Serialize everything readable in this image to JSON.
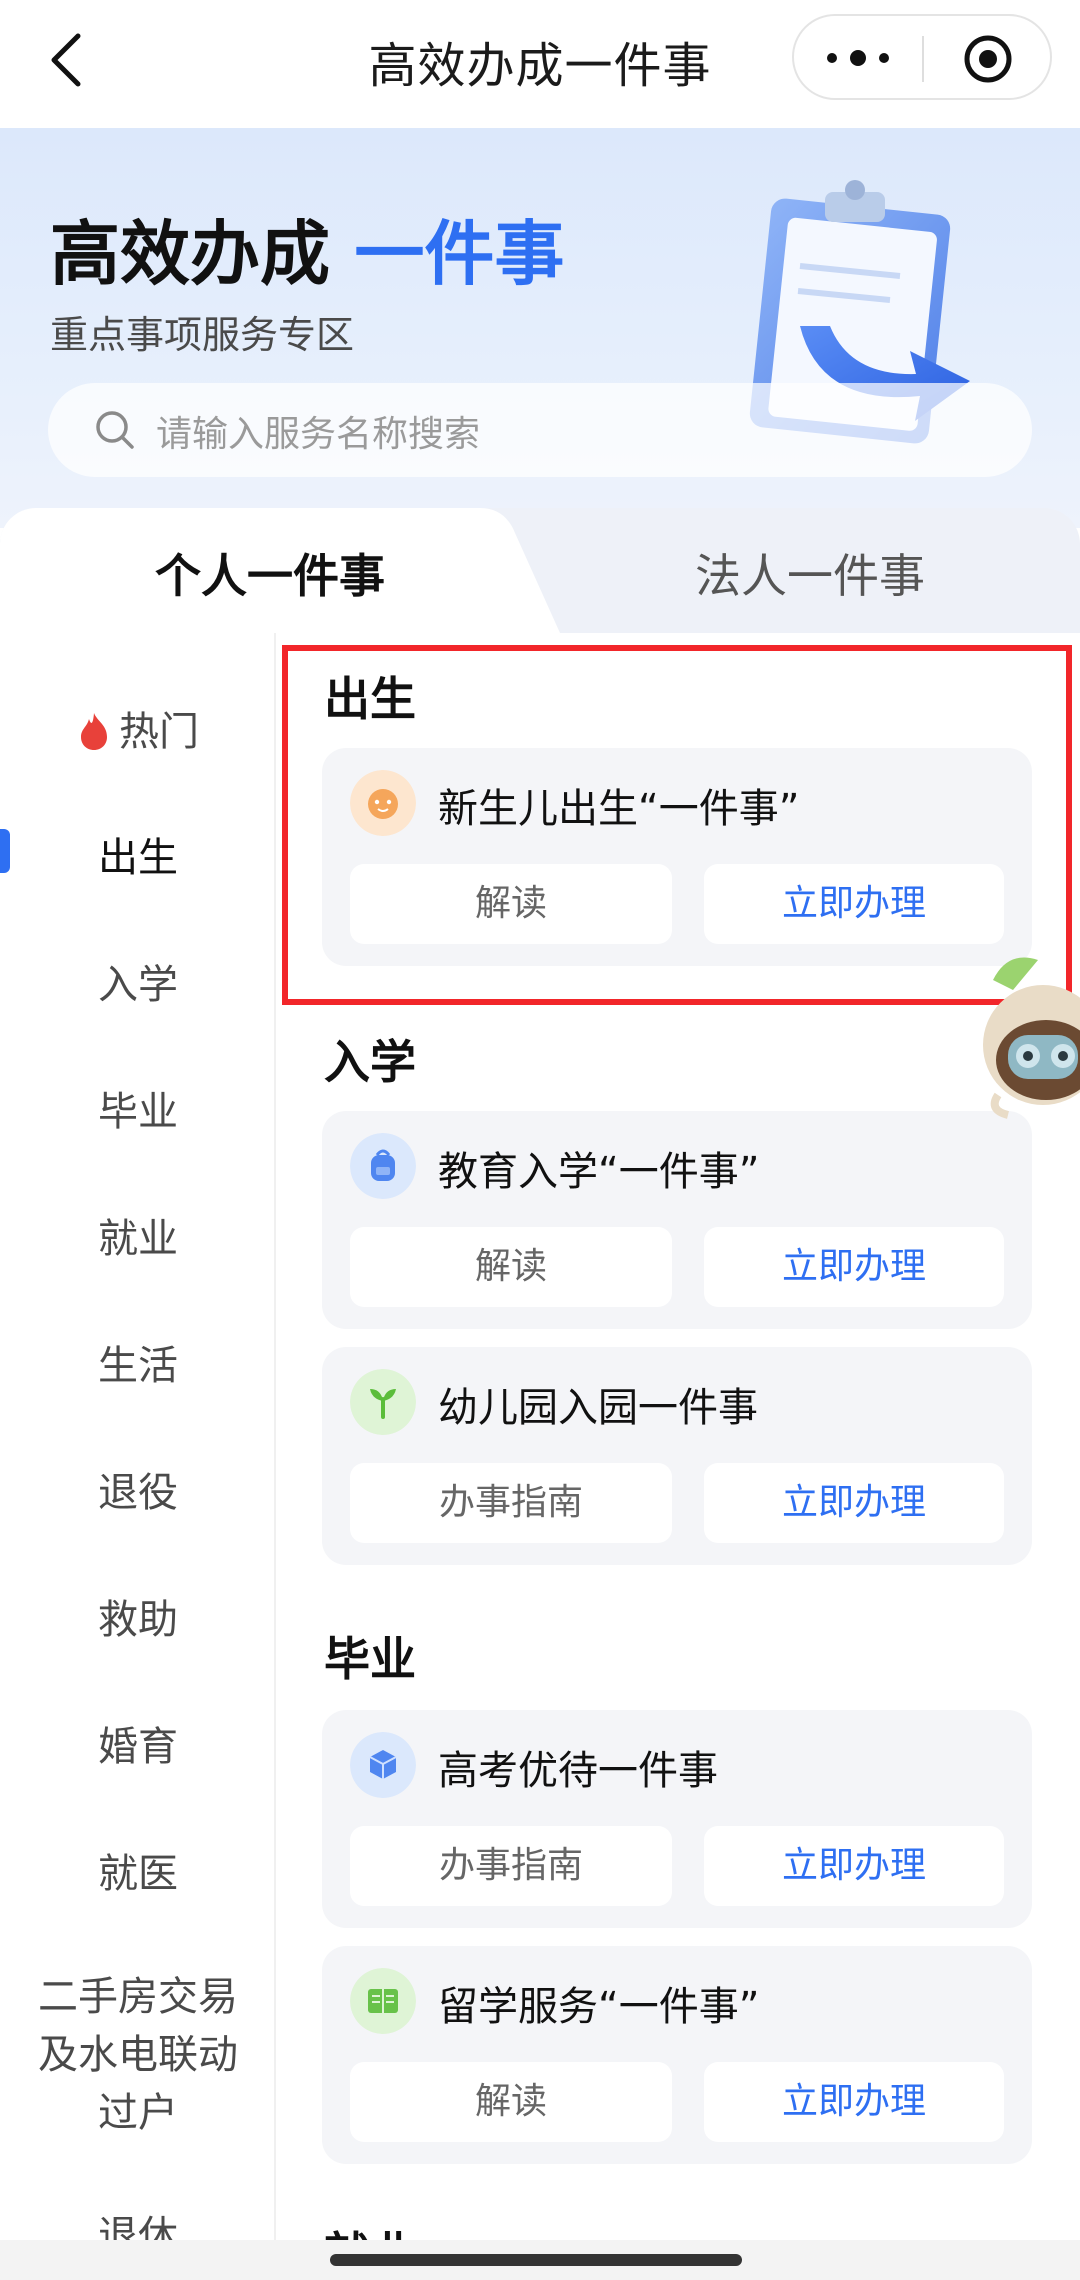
{
  "navbar": {
    "title": "高效办成一件事"
  },
  "banner": {
    "title_main": "高效办成 ",
    "title_highlight": "一件事",
    "subtitle": "重点事项服务专区"
  },
  "search": {
    "placeholder": "请输入服务名称搜索"
  },
  "tabs": [
    {
      "label": "个人一件事",
      "active": true
    },
    {
      "label": "法人一件事",
      "active": false
    }
  ],
  "sidebar": {
    "items": [
      {
        "label": "热门",
        "icon": "flame-icon"
      },
      {
        "label": "出生",
        "active": true
      },
      {
        "label": "入学"
      },
      {
        "label": "毕业"
      },
      {
        "label": "就业"
      },
      {
        "label": "生活"
      },
      {
        "label": "退役"
      },
      {
        "label": "救助"
      },
      {
        "label": "婚育"
      },
      {
        "label": "就医"
      },
      {
        "label": "二手房交易\n及水电联动\n过户"
      },
      {
        "label": "退休"
      }
    ]
  },
  "sections": [
    {
      "title": "出生",
      "cards": [
        {
          "title": "新生儿出生“一件事”",
          "icon": "baby-icon",
          "left_button": "解读",
          "right_button": "立即办理"
        }
      ]
    },
    {
      "title": "入学",
      "cards": [
        {
          "title": "教育入学“一件事”",
          "icon": "schoolbag-icon",
          "left_button": "解读",
          "right_button": "立即办理"
        },
        {
          "title": "幼儿园入园一件事",
          "icon": "sprout-icon",
          "left_button": "办事指南",
          "right_button": "立即办理"
        }
      ]
    },
    {
      "title": "毕业",
      "cards": [
        {
          "title": "高考优待一件事",
          "icon": "cube-icon",
          "left_button": "办事指南",
          "right_button": "立即办理"
        },
        {
          "title": "留学服务“一件事”",
          "icon": "book-icon",
          "left_button": "解读",
          "right_button": "立即办理"
        }
      ]
    },
    {
      "title": "就业"
    }
  ],
  "colors": {
    "accent": "#2e6ff2",
    "highlight_border": "#f2262a",
    "card_bg": "#f4f5f8"
  }
}
